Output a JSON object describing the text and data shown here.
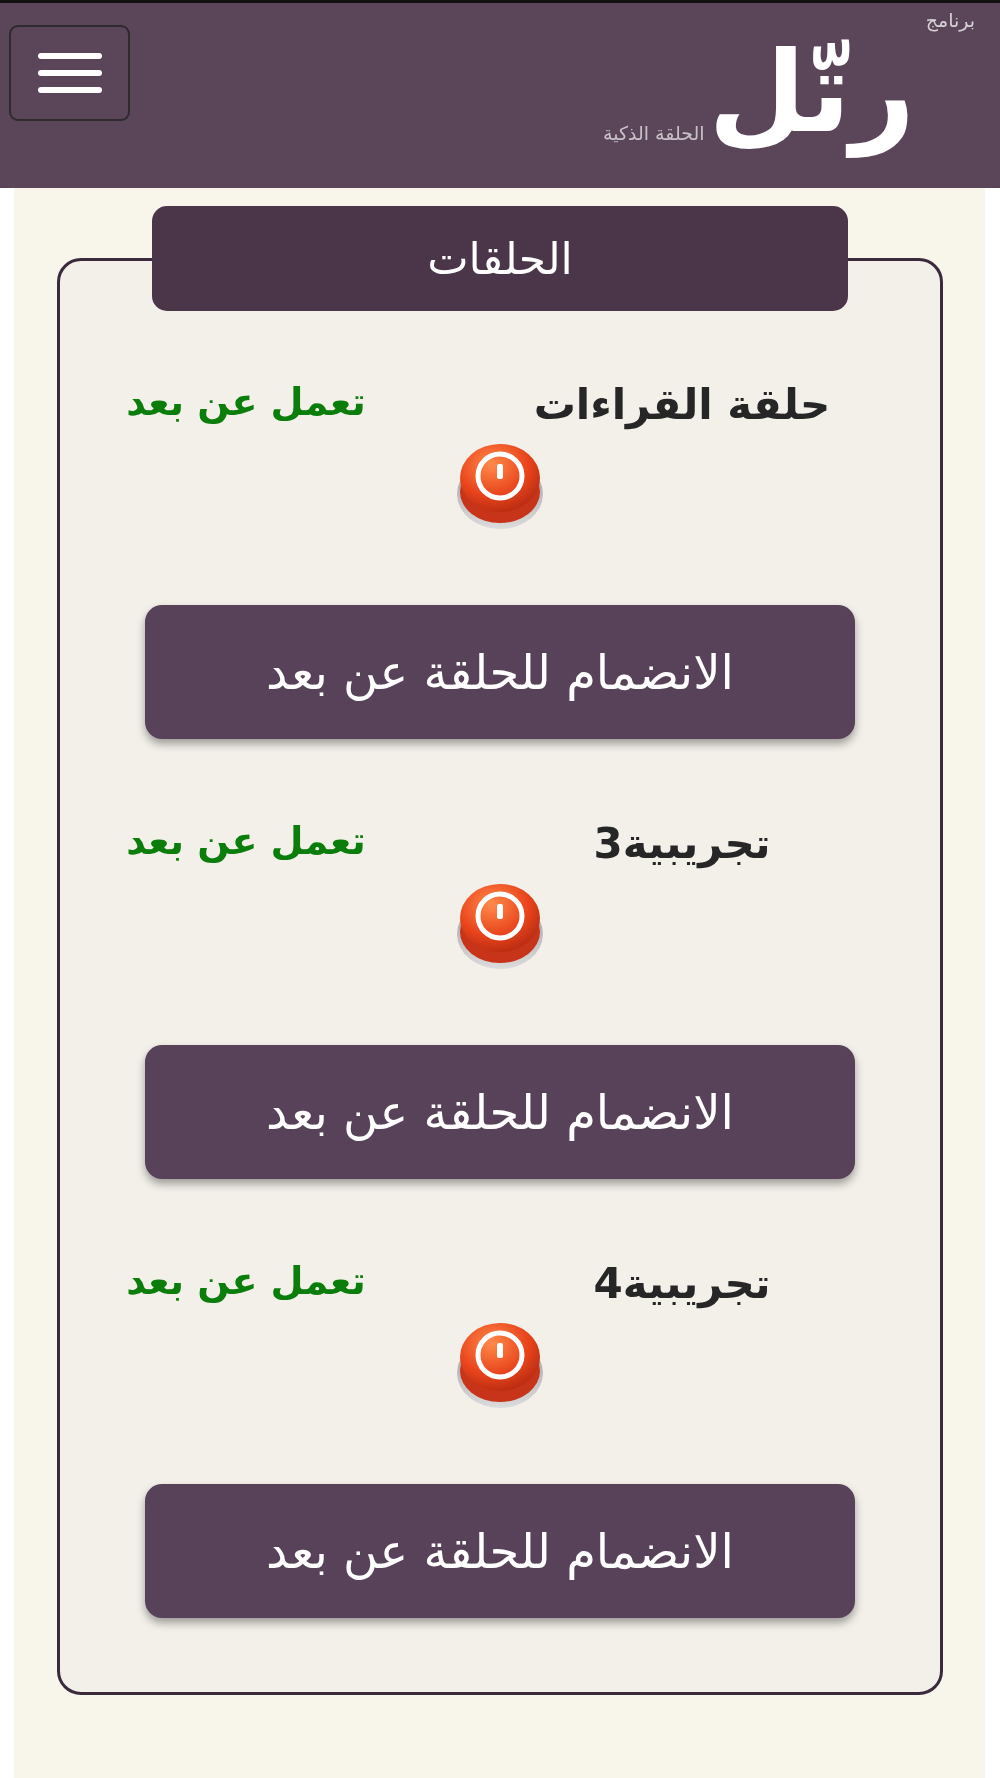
{
  "header": {
    "app_label": "برنامج",
    "logo": "رتّل",
    "tagline": "الحلقة الذكية"
  },
  "card": {
    "title": "الحلقات",
    "circles": [
      {
        "name": "حلقة القراءات",
        "status": "تعمل عن بعد",
        "join_button": "الانضمام للحلقة عن بعد"
      },
      {
        "name": "تجريبية3",
        "status": "تعمل عن بعد",
        "join_button": "الانضمام للحلقة عن بعد"
      },
      {
        "name": "تجريبية4",
        "status": "تعمل عن بعد",
        "join_button": "الانضمام للحلقة عن بعد"
      }
    ]
  }
}
